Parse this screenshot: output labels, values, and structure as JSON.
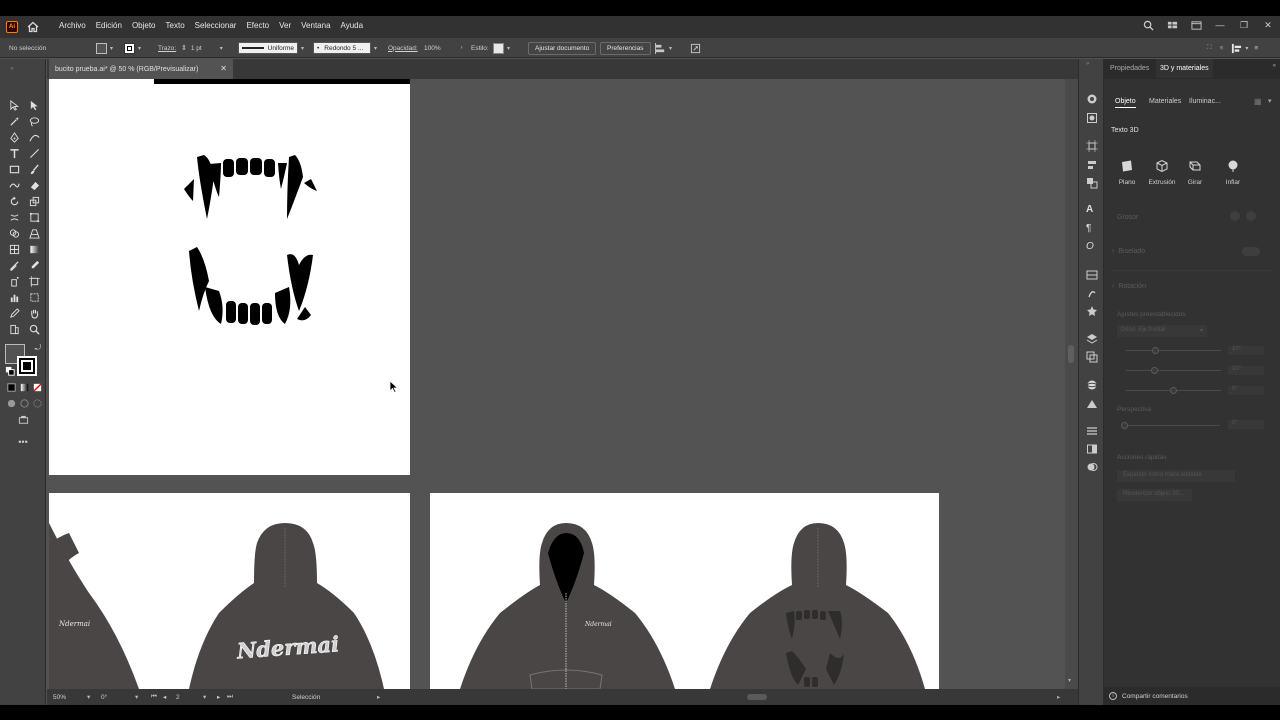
{
  "menu": {
    "items": [
      "Archivo",
      "Edición",
      "Objeto",
      "Texto",
      "Seleccionar",
      "Efecto",
      "Ver",
      "Ventana",
      "Ayuda"
    ]
  },
  "control_bar": {
    "selection": "No selección",
    "stroke_label": "Trazo:",
    "stroke_weight": "1 pt",
    "stroke_profile": "Uniforme",
    "brush": "Redondo 5 ...",
    "opacity_label": "Opacidad:",
    "opacity_value": "100%",
    "style_label": "Estilo:",
    "fit_document": "Ajustar documento",
    "preferences": "Preferencias"
  },
  "document": {
    "tab_title": "bucito prueba.ai* @ 50 % (RGB/Previsualizar)"
  },
  "status": {
    "zoom": "50%",
    "rotation": "0°",
    "artboard": "2",
    "tool": "Selección"
  },
  "artwork": {
    "hoodie_text": "Ndermai"
  },
  "panel": {
    "tabs": [
      "Propiedades",
      "3D y materiales"
    ],
    "subtabs": [
      "Objeto",
      "Materiales",
      "Iluminac..."
    ],
    "section_title": "Texto 3D",
    "shapes": [
      "Plano",
      "Extrusión",
      "Girar",
      "Inflar"
    ],
    "faded_labels": {
      "depth": "Grosor",
      "bevel": "Biselado",
      "rotation": "Rotación",
      "presets": "Ajustes preestablecidos",
      "preset_value": "Desd. Eje frontal",
      "x_value": "10°",
      "y_value": "10°",
      "z_value": "0°",
      "perspective": "Perspectiva",
      "perspective_value": "0°",
      "quick_actions": "Acciones rápidas",
      "action_1": "Expandir como malla editable",
      "action_2": "Renderizar objeto 3D..."
    },
    "share": "Compartir comentarios"
  },
  "colors": {
    "app_bg": "#535353",
    "panel_bg": "#323232",
    "accent_logo": "#ff9a00",
    "hoodie_gray": "#4a4646"
  }
}
